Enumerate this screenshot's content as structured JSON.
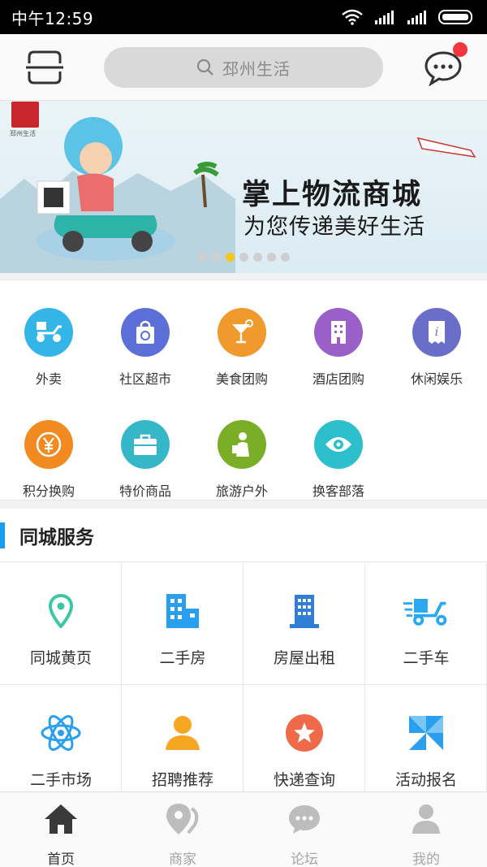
{
  "status_bar": {
    "time": "中午12:59"
  },
  "header": {
    "search_placeholder": "邳州生活"
  },
  "banner": {
    "title": "掌上物流商城",
    "subtitle": "为您传递美好生活",
    "dot_count": 7,
    "active_dot": 3
  },
  "categories": [
    {
      "label": "外卖",
      "icon": "scooter-icon",
      "color": "#33b5e8"
    },
    {
      "label": "社区超市",
      "icon": "shopping-bag-icon",
      "color": "#5c6fd8"
    },
    {
      "label": "美食团购",
      "icon": "cocktail-icon",
      "color": "#f09a2e"
    },
    {
      "label": "酒店团购",
      "icon": "building-icon",
      "color": "#9a5fc9"
    },
    {
      "label": "休闲娱乐",
      "icon": "ticket-icon",
      "color": "#6a6ec8"
    },
    {
      "label": "积分换购",
      "icon": "yen-coin-icon",
      "color": "#f28a22"
    },
    {
      "label": "特价商品",
      "icon": "briefcase-icon",
      "color": "#35b7c7"
    },
    {
      "label": "旅游户外",
      "icon": "traveler-icon",
      "color": "#7aae27"
    },
    {
      "label": "换客部落",
      "icon": "eye-icon",
      "color": "#2dbfcc"
    }
  ],
  "section": {
    "title": "同城服务",
    "items": [
      {
        "label": "同城黄页",
        "icon": "location-pin-icon",
        "color": "#3cc7a5"
      },
      {
        "label": "二手房",
        "icon": "apartment-icon",
        "color": "#2a9ff0"
      },
      {
        "label": "房屋出租",
        "icon": "tower-icon",
        "color": "#2f7fd6"
      },
      {
        "label": "二手车",
        "icon": "delivery-scooter-icon",
        "color": "#2aa8f0"
      },
      {
        "label": "二手市场",
        "icon": "atom-icon",
        "color": "#2a9ff0"
      },
      {
        "label": "招聘推荐",
        "icon": "person-icon",
        "color": "#f5a623"
      },
      {
        "label": "快递查询",
        "icon": "star-badge-icon",
        "color": "#f06a4a"
      },
      {
        "label": "活动报名",
        "icon": "pinwheel-icon",
        "color": "#2a9ff0"
      }
    ]
  },
  "tabbar": {
    "tabs": [
      {
        "label": "首页",
        "icon": "home-icon",
        "active": true
      },
      {
        "label": "商家",
        "icon": "map-pin-icon",
        "active": false
      },
      {
        "label": "论坛",
        "icon": "chat-bubble-icon",
        "active": false
      },
      {
        "label": "我的",
        "icon": "user-icon",
        "active": false
      }
    ]
  },
  "colors": {
    "accent": "#1a9cf0",
    "notification": "#f2373c"
  }
}
